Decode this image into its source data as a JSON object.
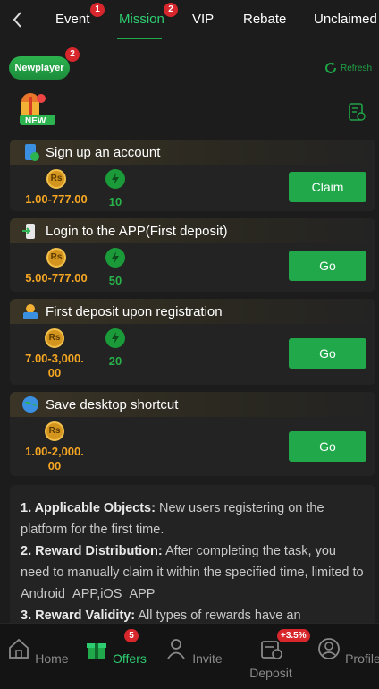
{
  "nav": {
    "tabs": [
      {
        "label": "Event",
        "badge": "1"
      },
      {
        "label": "Mission",
        "badge": "2"
      },
      {
        "label": "VIP"
      },
      {
        "label": "Rebate"
      },
      {
        "label": "Unclaimed"
      }
    ],
    "active_tab": "Mission"
  },
  "newplayer": {
    "label": "Newplayer",
    "badge": "2"
  },
  "refresh_label": "Refresh",
  "new_label": "NEW",
  "tasks": [
    {
      "title": "Sign up an account",
      "coin_label": "Rs",
      "amount": "1.00-777.00",
      "points": "10",
      "action": "Claim",
      "icon": "phone-check-icon"
    },
    {
      "title": "Login to the APP(First deposit)",
      "coin_label": "Rs",
      "amount": "5.00-777.00",
      "points": "50",
      "action": "Go",
      "icon": "app-login-icon"
    },
    {
      "title": "First deposit upon registration",
      "coin_label": "Rs",
      "amount_line1": "7.00-3,000.",
      "amount_line2": "00",
      "points": "20",
      "action": "Go",
      "icon": "deposit-icon"
    },
    {
      "title": "Save desktop shortcut",
      "coin_label": "Rs",
      "amount_line1": "1.00-2,000.",
      "amount_line2": "00",
      "action": "Go",
      "icon": "globe-icon"
    }
  ],
  "rules": {
    "r1_label": "1. Applicable Objects:",
    "r1_text": " New users registering on the platform for the first time.",
    "r2_label": "2. Reward Distribution:",
    "r2_text": " After completing the task, you need to manually claim it within the specified time, limited to Android_APP,iOS_APP",
    "r3_label": "3. Reward Validity:",
    "r3_text": " All types of rewards have an"
  },
  "bottom_nav": {
    "items": [
      {
        "label": "Home",
        "icon": "home-icon"
      },
      {
        "label": "Offers",
        "icon": "gift-icon",
        "badge": "5"
      },
      {
        "label": "Invite",
        "icon": "invite-icon"
      },
      {
        "label": "Deposit",
        "icon": "deposit-icon",
        "badge": "+3.5%"
      },
      {
        "label": "Profile",
        "icon": "profile-icon"
      }
    ],
    "active": "Offers"
  },
  "colors": {
    "accent": "#20a84a",
    "gold": "#f5a623",
    "badge": "#d7262c",
    "bg": "#1c1c1c"
  }
}
